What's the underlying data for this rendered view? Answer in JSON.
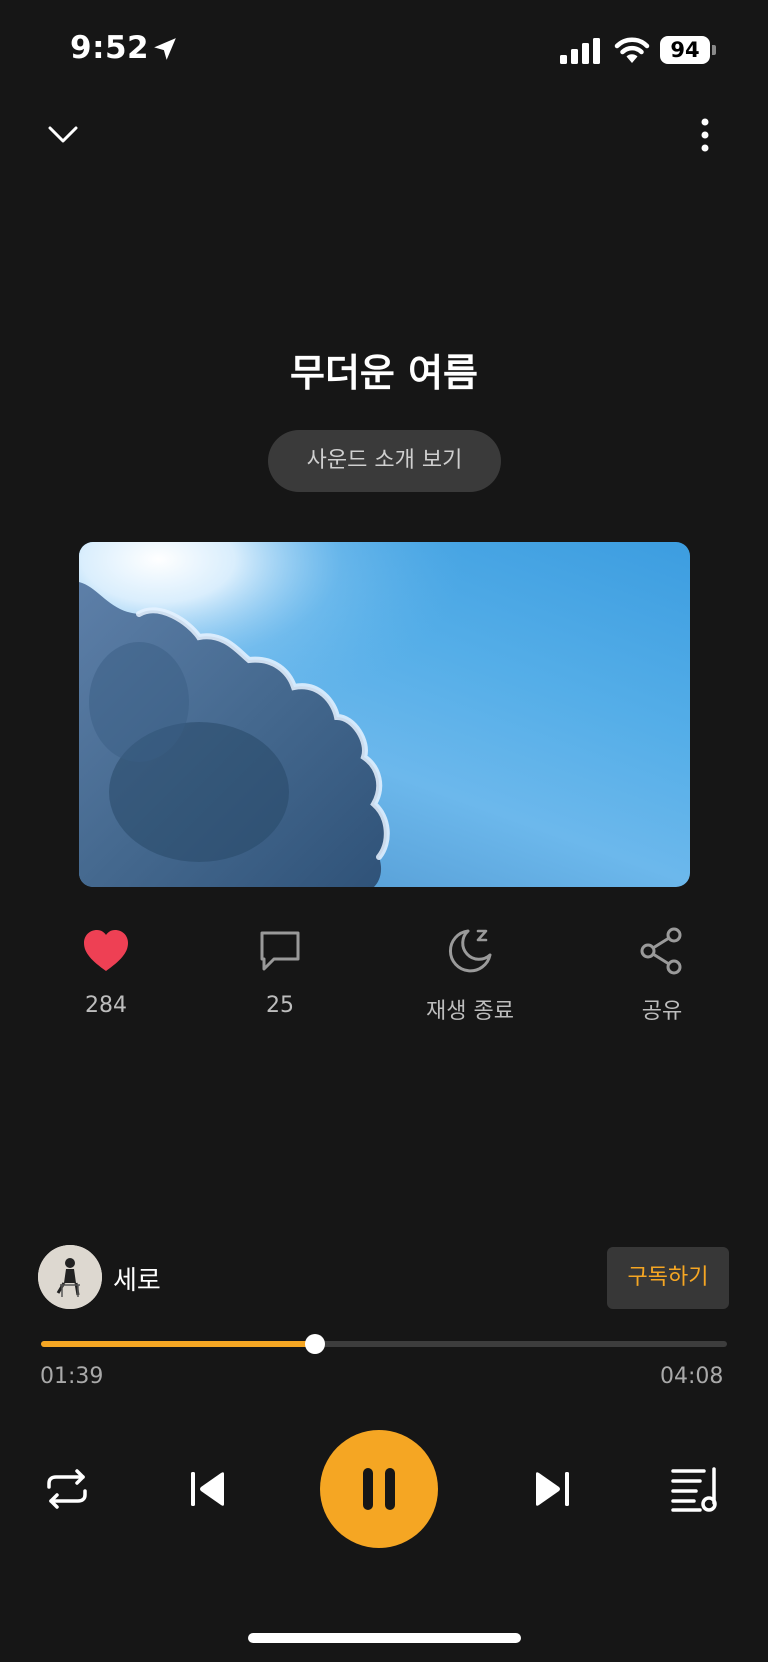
{
  "status_bar": {
    "time": "9:52",
    "battery": "94",
    "icons": [
      "location-arrow-icon",
      "signal-icon",
      "wifi-icon",
      "battery-icon"
    ]
  },
  "nav": {
    "collapse_icon": "chevron-down-icon",
    "more_icon": "more-vertical-icon"
  },
  "track": {
    "title": "무더운 여름",
    "intro_button": "사운드 소개 보기",
    "artwork_icon": "sky-clouds-image"
  },
  "actions": {
    "like": {
      "icon": "heart-icon",
      "label": "284"
    },
    "comment": {
      "icon": "comment-icon",
      "label": "25"
    },
    "sleep": {
      "icon": "moon-sleep-icon",
      "label": "재생 종료"
    },
    "share": {
      "icon": "share-icon",
      "label": "공유"
    }
  },
  "artist": {
    "name": "세로",
    "subscribe_label": "구독하기"
  },
  "progress": {
    "current": "01:39",
    "total": "04:08",
    "fraction": 0.399
  },
  "controls": {
    "repeat_icon": "repeat-icon",
    "prev_icon": "skip-previous-icon",
    "play_pause_icon": "pause-icon",
    "next_icon": "skip-next-icon",
    "queue_icon": "playlist-icon"
  },
  "colors": {
    "background": "#161616",
    "accent": "#f5a623",
    "like": "#ee4054",
    "secondary_text": "#bdbdbd"
  }
}
